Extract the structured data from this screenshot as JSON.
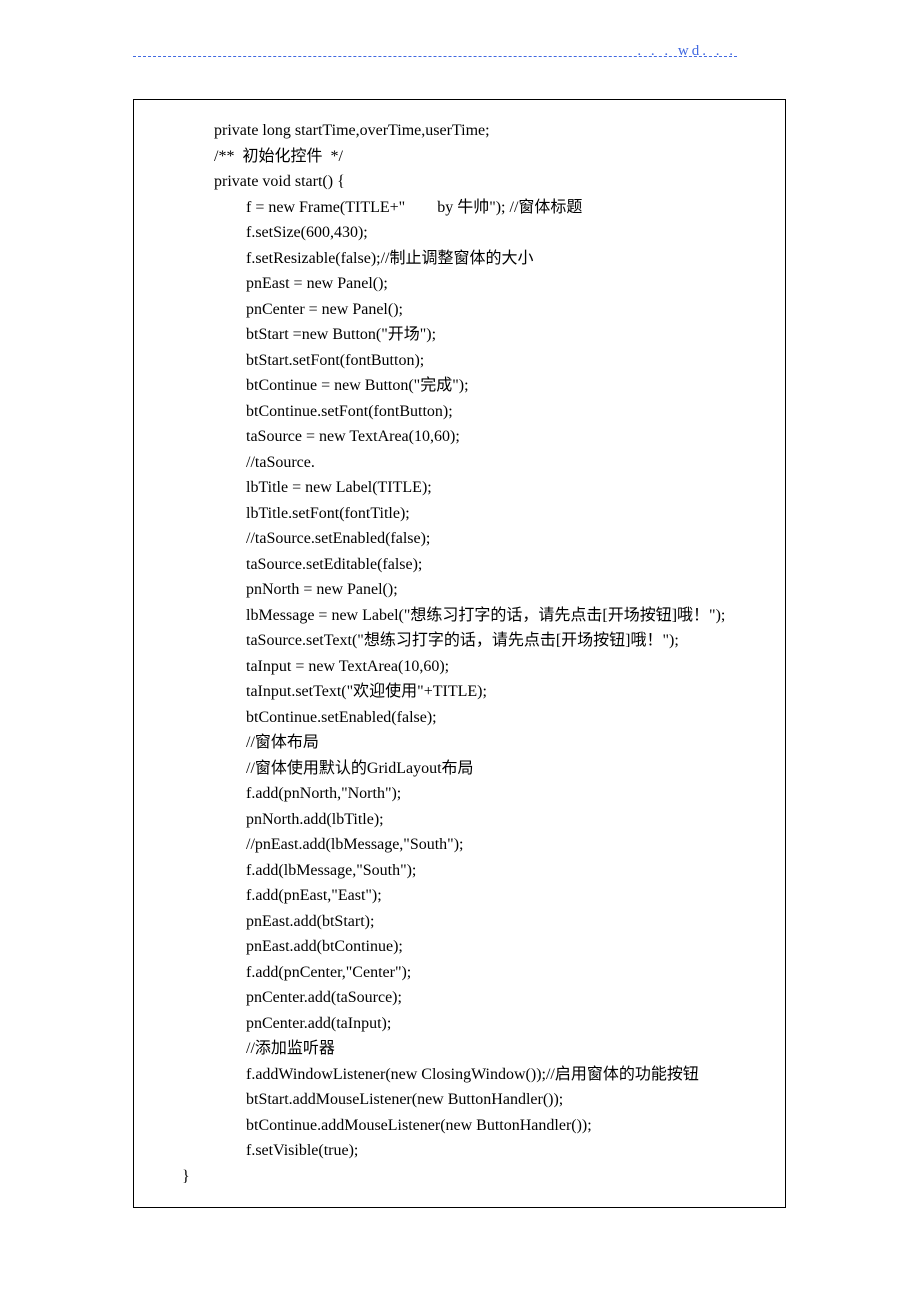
{
  "header": {
    "text": ". . . wd. . ."
  },
  "code": {
    "lines": [
      {
        "indent": 0,
        "text": "        private long startTime,overTime,userTime;"
      },
      {
        "indent": 0,
        "text": "        /**  初始化控件  */"
      },
      {
        "indent": 0,
        "text": "        private void start() {"
      },
      {
        "indent": 0,
        "text": "                f = new Frame(TITLE+\"        by 牛帅\"); //窗体标题"
      },
      {
        "indent": 0,
        "text": "                f.setSize(600,430);"
      },
      {
        "indent": 0,
        "text": "                f.setResizable(false);//制止调整窗体的大小"
      },
      {
        "indent": 0,
        "text": "                pnEast = new Panel();"
      },
      {
        "indent": 0,
        "text": "                pnCenter = new Panel();"
      },
      {
        "indent": 0,
        "text": "                btStart =new Button(\"开场\");"
      },
      {
        "indent": 0,
        "text": "                btStart.setFont(fontButton);"
      },
      {
        "indent": 0,
        "text": "                btContinue = new Button(\"完成\");"
      },
      {
        "indent": 0,
        "text": "                btContinue.setFont(fontButton);"
      },
      {
        "indent": 0,
        "text": "                taSource = new TextArea(10,60);"
      },
      {
        "indent": 0,
        "text": "                //taSource."
      },
      {
        "indent": 0,
        "text": "                lbTitle = new Label(TITLE);"
      },
      {
        "indent": 0,
        "text": "                lbTitle.setFont(fontTitle);"
      },
      {
        "indent": 0,
        "text": "                //taSource.setEnabled(false);"
      },
      {
        "indent": 0,
        "text": "                taSource.setEditable(false);"
      },
      {
        "indent": 0,
        "text": "                pnNorth = new Panel();"
      },
      {
        "indent": 0,
        "text": "                lbMessage = new Label(\"想练习打字的话，请先点击[开场按钮]哦！\");"
      },
      {
        "indent": 0,
        "text": "                taSource.setText(\"想练习打字的话，请先点击[开场按钮]哦！\");"
      },
      {
        "indent": 0,
        "text": "                taInput = new TextArea(10,60);"
      },
      {
        "indent": 0,
        "text": "                taInput.setText(\"欢迎使用\"+TITLE);"
      },
      {
        "indent": 0,
        "text": "                btContinue.setEnabled(false);"
      },
      {
        "indent": 0,
        "text": "                //窗体布局"
      },
      {
        "indent": 0,
        "text": "                //窗体使用默认的GridLayout布局"
      },
      {
        "indent": 0,
        "text": "                f.add(pnNorth,\"North\");"
      },
      {
        "indent": 0,
        "text": "                pnNorth.add(lbTitle);"
      },
      {
        "indent": 0,
        "text": "                //pnEast.add(lbMessage,\"South\");"
      },
      {
        "indent": 0,
        "text": "                f.add(lbMessage,\"South\");"
      },
      {
        "indent": 0,
        "text": "                f.add(pnEast,\"East\");"
      },
      {
        "indent": 0,
        "text": "                pnEast.add(btStart);"
      },
      {
        "indent": 0,
        "text": "                pnEast.add(btContinue);"
      },
      {
        "indent": 0,
        "text": "                f.add(pnCenter,\"Center\");"
      },
      {
        "indent": 0,
        "text": "                pnCenter.add(taSource);"
      },
      {
        "indent": 0,
        "text": "                pnCenter.add(taInput);"
      },
      {
        "indent": 0,
        "text": "                //添加监听器"
      },
      {
        "indent": 0,
        "text": "                f.addWindowListener(new ClosingWindow());//启用窗体的功能按钮"
      },
      {
        "indent": 0,
        "text": "                btStart.addMouseListener(new ButtonHandler());"
      },
      {
        "indent": 0,
        "text": "                btContinue.addMouseListener(new ButtonHandler());"
      },
      {
        "indent": 0,
        "text": "                f.setVisible(true);"
      },
      {
        "indent": 0,
        "text": "}"
      }
    ]
  }
}
